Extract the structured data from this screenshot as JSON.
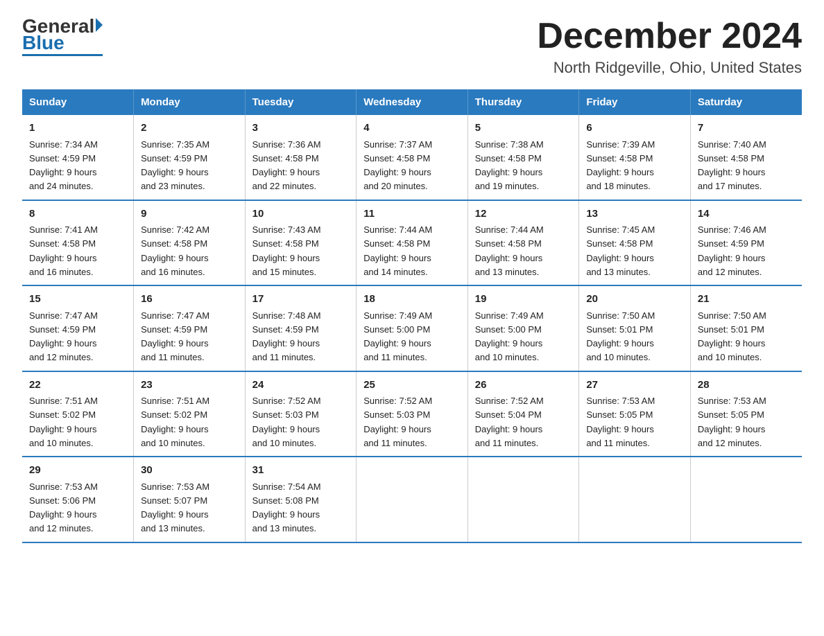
{
  "logo": {
    "general": "General",
    "blue": "Blue"
  },
  "title": "December 2024",
  "subtitle": "North Ridgeville, Ohio, United States",
  "days_header": [
    "Sunday",
    "Monday",
    "Tuesday",
    "Wednesday",
    "Thursday",
    "Friday",
    "Saturday"
  ],
  "weeks": [
    [
      {
        "day": "1",
        "sunrise": "7:34 AM",
        "sunset": "4:59 PM",
        "daylight": "9 hours and 24 minutes."
      },
      {
        "day": "2",
        "sunrise": "7:35 AM",
        "sunset": "4:59 PM",
        "daylight": "9 hours and 23 minutes."
      },
      {
        "day": "3",
        "sunrise": "7:36 AM",
        "sunset": "4:58 PM",
        "daylight": "9 hours and 22 minutes."
      },
      {
        "day": "4",
        "sunrise": "7:37 AM",
        "sunset": "4:58 PM",
        "daylight": "9 hours and 20 minutes."
      },
      {
        "day": "5",
        "sunrise": "7:38 AM",
        "sunset": "4:58 PM",
        "daylight": "9 hours and 19 minutes."
      },
      {
        "day": "6",
        "sunrise": "7:39 AM",
        "sunset": "4:58 PM",
        "daylight": "9 hours and 18 minutes."
      },
      {
        "day": "7",
        "sunrise": "7:40 AM",
        "sunset": "4:58 PM",
        "daylight": "9 hours and 17 minutes."
      }
    ],
    [
      {
        "day": "8",
        "sunrise": "7:41 AM",
        "sunset": "4:58 PM",
        "daylight": "9 hours and 16 minutes."
      },
      {
        "day": "9",
        "sunrise": "7:42 AM",
        "sunset": "4:58 PM",
        "daylight": "9 hours and 16 minutes."
      },
      {
        "day": "10",
        "sunrise": "7:43 AM",
        "sunset": "4:58 PM",
        "daylight": "9 hours and 15 minutes."
      },
      {
        "day": "11",
        "sunrise": "7:44 AM",
        "sunset": "4:58 PM",
        "daylight": "9 hours and 14 minutes."
      },
      {
        "day": "12",
        "sunrise": "7:44 AM",
        "sunset": "4:58 PM",
        "daylight": "9 hours and 13 minutes."
      },
      {
        "day": "13",
        "sunrise": "7:45 AM",
        "sunset": "4:58 PM",
        "daylight": "9 hours and 13 minutes."
      },
      {
        "day": "14",
        "sunrise": "7:46 AM",
        "sunset": "4:59 PM",
        "daylight": "9 hours and 12 minutes."
      }
    ],
    [
      {
        "day": "15",
        "sunrise": "7:47 AM",
        "sunset": "4:59 PM",
        "daylight": "9 hours and 12 minutes."
      },
      {
        "day": "16",
        "sunrise": "7:47 AM",
        "sunset": "4:59 PM",
        "daylight": "9 hours and 11 minutes."
      },
      {
        "day": "17",
        "sunrise": "7:48 AM",
        "sunset": "4:59 PM",
        "daylight": "9 hours and 11 minutes."
      },
      {
        "day": "18",
        "sunrise": "7:49 AM",
        "sunset": "5:00 PM",
        "daylight": "9 hours and 11 minutes."
      },
      {
        "day": "19",
        "sunrise": "7:49 AM",
        "sunset": "5:00 PM",
        "daylight": "9 hours and 10 minutes."
      },
      {
        "day": "20",
        "sunrise": "7:50 AM",
        "sunset": "5:01 PM",
        "daylight": "9 hours and 10 minutes."
      },
      {
        "day": "21",
        "sunrise": "7:50 AM",
        "sunset": "5:01 PM",
        "daylight": "9 hours and 10 minutes."
      }
    ],
    [
      {
        "day": "22",
        "sunrise": "7:51 AM",
        "sunset": "5:02 PM",
        "daylight": "9 hours and 10 minutes."
      },
      {
        "day": "23",
        "sunrise": "7:51 AM",
        "sunset": "5:02 PM",
        "daylight": "9 hours and 10 minutes."
      },
      {
        "day": "24",
        "sunrise": "7:52 AM",
        "sunset": "5:03 PM",
        "daylight": "9 hours and 10 minutes."
      },
      {
        "day": "25",
        "sunrise": "7:52 AM",
        "sunset": "5:03 PM",
        "daylight": "9 hours and 11 minutes."
      },
      {
        "day": "26",
        "sunrise": "7:52 AM",
        "sunset": "5:04 PM",
        "daylight": "9 hours and 11 minutes."
      },
      {
        "day": "27",
        "sunrise": "7:53 AM",
        "sunset": "5:05 PM",
        "daylight": "9 hours and 11 minutes."
      },
      {
        "day": "28",
        "sunrise": "7:53 AM",
        "sunset": "5:05 PM",
        "daylight": "9 hours and 12 minutes."
      }
    ],
    [
      {
        "day": "29",
        "sunrise": "7:53 AM",
        "sunset": "5:06 PM",
        "daylight": "9 hours and 12 minutes."
      },
      {
        "day": "30",
        "sunrise": "7:53 AM",
        "sunset": "5:07 PM",
        "daylight": "9 hours and 13 minutes."
      },
      {
        "day": "31",
        "sunrise": "7:54 AM",
        "sunset": "5:08 PM",
        "daylight": "9 hours and 13 minutes."
      },
      null,
      null,
      null,
      null
    ]
  ],
  "labels": {
    "sunrise": "Sunrise:",
    "sunset": "Sunset:",
    "daylight": "Daylight:"
  },
  "colors": {
    "header_bg": "#2a7abf",
    "header_text": "#ffffff",
    "border": "#2a7abf"
  }
}
